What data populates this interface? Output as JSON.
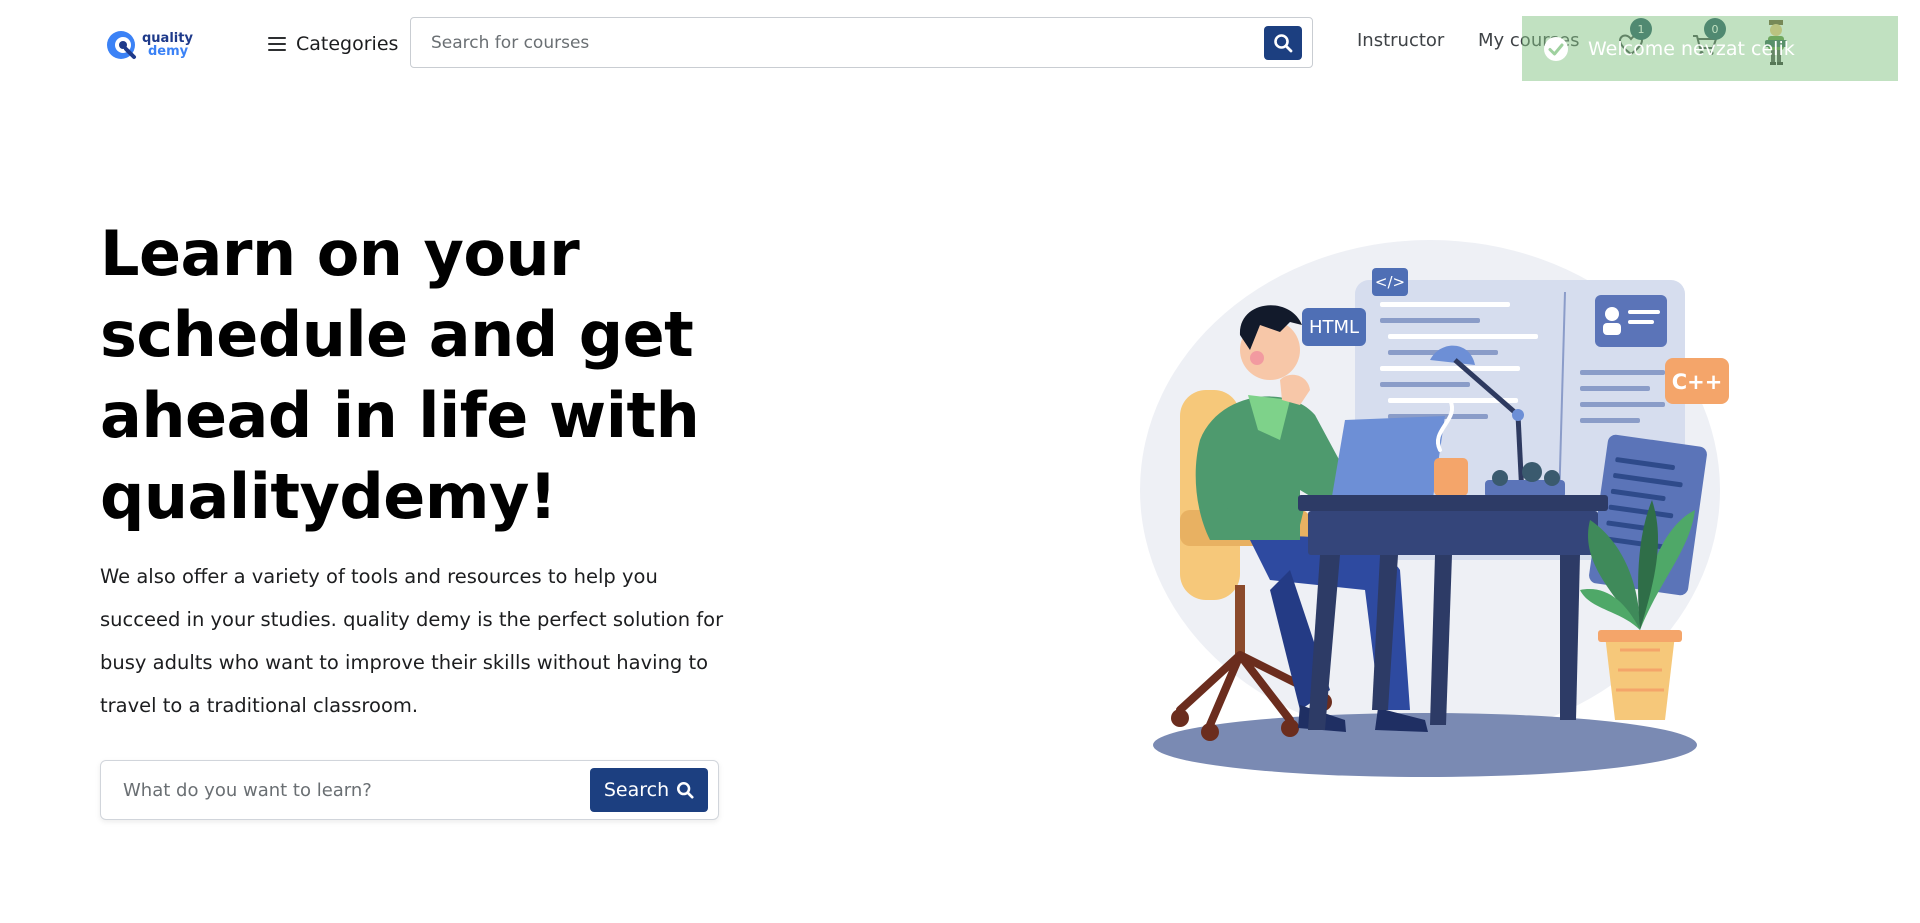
{
  "header": {
    "logo": {
      "line1": "quality",
      "line2": "demy"
    },
    "categories_label": "Categories",
    "search_placeholder": "Search for courses",
    "nav": {
      "instructor": "Instructor",
      "my_courses": "My courses"
    },
    "wishlist_count": "1",
    "cart_count": "0"
  },
  "toast": {
    "message": "Welcome nevzat celik"
  },
  "hero": {
    "title": "Learn on your schedule and get ahead in life with qualitydemy!",
    "description": "We also offer a variety of tools and resources to help you succeed in your studies. quality demy is the perfect solution for busy adults who want to improve their skills without having to travel to a traditional classroom.",
    "search_placeholder": "What do you want to learn?",
    "search_button": "Search"
  },
  "illustration": {
    "tag_code": "</>",
    "tag_html": "HTML",
    "tag_cpp": "C++"
  },
  "colors": {
    "primary": "#1c3f80",
    "badge": "#1d4f5e",
    "toast_bg": "#83c483",
    "logo_dark": "#1e3a8a",
    "logo_light": "#3b82f6"
  },
  "icons": [
    "menu-icon",
    "search-icon",
    "heart-icon",
    "cart-icon",
    "check-circle-icon",
    "avatar-icon"
  ]
}
